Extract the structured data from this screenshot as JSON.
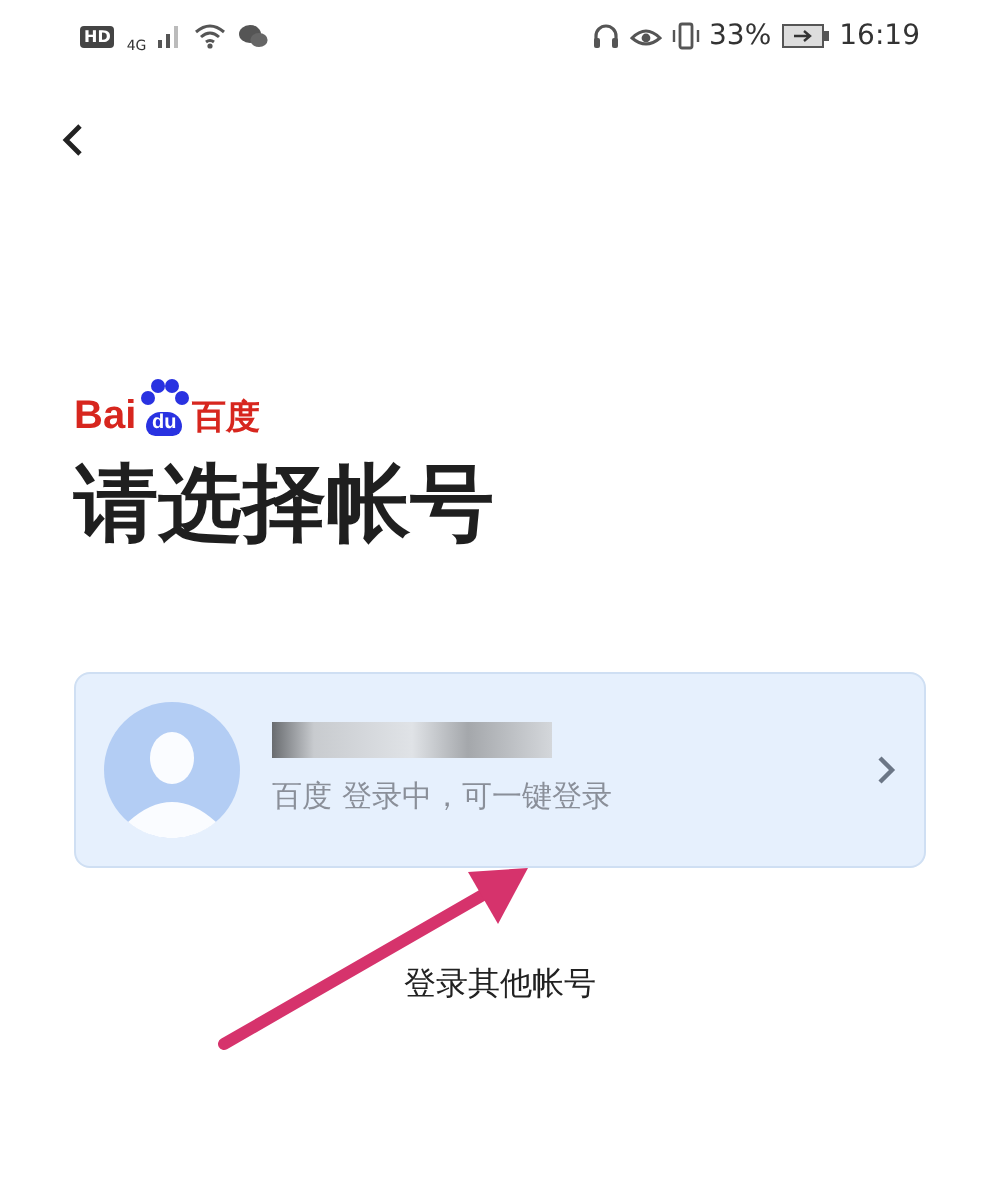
{
  "status_bar": {
    "hd": "HD",
    "network": "4G",
    "battery": "33%",
    "time": "16:19"
  },
  "logo": {
    "latin": "Bai",
    "paw": "du",
    "chinese": "百度"
  },
  "title": "请选择帐号",
  "account": {
    "status": "百度 登录中，可一键登录"
  },
  "other_account": "登录其他帐号"
}
